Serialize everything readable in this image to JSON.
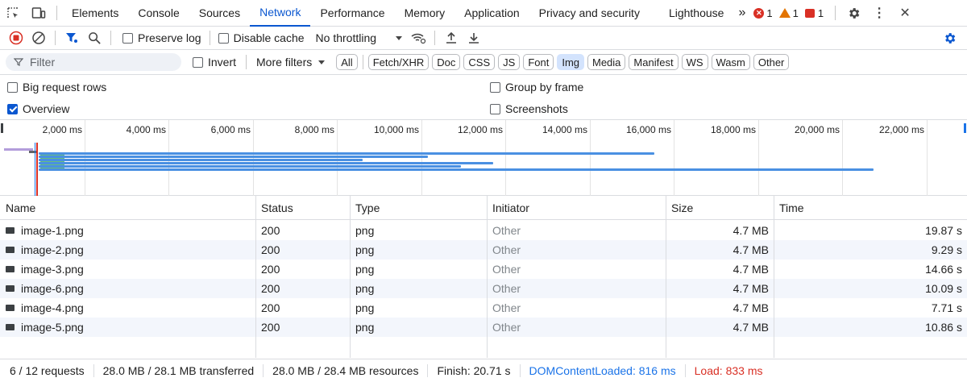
{
  "tabs": [
    {
      "label": "Elements"
    },
    {
      "label": "Console"
    },
    {
      "label": "Sources"
    },
    {
      "label": "Network"
    },
    {
      "label": "Performance"
    },
    {
      "label": "Memory"
    },
    {
      "label": "Application"
    },
    {
      "label": "Privacy and security"
    },
    {
      "label": "Lighthouse"
    }
  ],
  "active_tab": "Network",
  "more_tabs": "»",
  "counters": {
    "errors": "1",
    "warnings": "1",
    "issues": "1"
  },
  "colors": {
    "accent": "#0b57d0",
    "error": "#d93025",
    "warning": "#e37400",
    "load": "#d93025",
    "dcl": "#1a73e8",
    "bar": "#4a90e2"
  },
  "toolbar": {
    "preserve_log": "Preserve log",
    "disable_cache": "Disable cache",
    "throttling": "No throttling"
  },
  "filter": {
    "placeholder": "Filter",
    "invert": "Invert",
    "more_filters": "More filters",
    "types": [
      "All",
      "Fetch/XHR",
      "Doc",
      "CSS",
      "JS",
      "Font",
      "Img",
      "Media",
      "Manifest",
      "WS",
      "Wasm",
      "Other"
    ],
    "selected": "Img"
  },
  "settings": {
    "big_rows": "Big request rows",
    "overview": "Overview",
    "group_by_frame": "Group by frame",
    "screenshots": "Screenshots"
  },
  "overview_ticks": [
    "2,000 ms",
    "4,000 ms",
    "6,000 ms",
    "8,000 ms",
    "10,000 ms",
    "12,000 ms",
    "14,000 ms",
    "16,000 ms",
    "18,000 ms",
    "20,000 ms",
    "22,000 ms"
  ],
  "table": {
    "headers": {
      "name": "Name",
      "status": "Status",
      "type": "Type",
      "initiator": "Initiator",
      "size": "Size",
      "time": "Time"
    },
    "rows": [
      {
        "name": "image-1.png",
        "status": "200",
        "type": "png",
        "initiator": "Other",
        "size": "4.7 MB",
        "time": "19.87 s"
      },
      {
        "name": "image-2.png",
        "status": "200",
        "type": "png",
        "initiator": "Other",
        "size": "4.7 MB",
        "time": "9.29 s"
      },
      {
        "name": "image-3.png",
        "status": "200",
        "type": "png",
        "initiator": "Other",
        "size": "4.7 MB",
        "time": "14.66 s"
      },
      {
        "name": "image-6.png",
        "status": "200",
        "type": "png",
        "initiator": "Other",
        "size": "4.7 MB",
        "time": "10.09 s"
      },
      {
        "name": "image-4.png",
        "status": "200",
        "type": "png",
        "initiator": "Other",
        "size": "4.7 MB",
        "time": "7.71 s"
      },
      {
        "name": "image-5.png",
        "status": "200",
        "type": "png",
        "initiator": "Other",
        "size": "4.7 MB",
        "time": "10.86 s"
      }
    ]
  },
  "status": {
    "requests": "6 / 12 requests",
    "transferred": "28.0 MB / 28.1 MB transferred",
    "resources": "28.0 MB / 28.4 MB resources",
    "finish": "Finish: 20.71 s",
    "dcl": "DOMContentLoaded: 816 ms",
    "load": "Load: 833 ms"
  }
}
